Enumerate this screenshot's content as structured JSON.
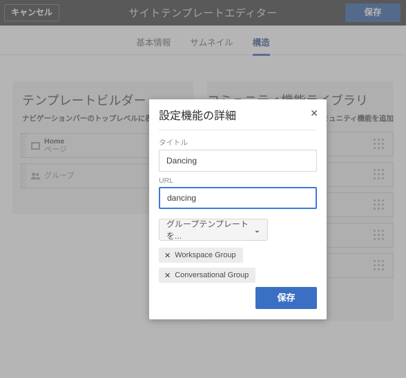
{
  "topbar": {
    "cancel_label": "キャンセル",
    "title": "サイトテンプレートエディター",
    "save_label": "保存"
  },
  "tabs": [
    {
      "label": "基本情報",
      "active": false
    },
    {
      "label": "サムネイル",
      "active": false
    },
    {
      "label": "構造",
      "active": true
    }
  ],
  "left_panel": {
    "title": "テンプレートビルダー",
    "subtitle": "ナビゲーションバーのトップレベルに表示さ",
    "rows": [
      {
        "icon": "page-icon",
        "title": "Home",
        "subtitle": "ページ"
      },
      {
        "icon": "group-icon",
        "title": "",
        "subtitle": "グループ"
      }
    ]
  },
  "right_panel": {
    "title": "コミュニティ機能ライブラリ",
    "subtitle": "コミュニティ機能を追加",
    "rows": [
      {
        "handle": "drag-handle-icon"
      },
      {
        "handle": "drag-handle-icon"
      },
      {
        "handle": "drag-handle-icon"
      },
      {
        "handle": "drag-handle-icon"
      },
      {
        "handle": "drag-handle-icon"
      }
    ]
  },
  "modal": {
    "title": "設定機能の詳細",
    "close_label": "✕",
    "title_field": {
      "label": "タイトル",
      "value": "Dancing",
      "placeholder": "タイトル"
    },
    "url_field": {
      "label": "URL",
      "value": "dancing",
      "placeholder": "URL"
    },
    "select": {
      "value": "グループテンプレートを...",
      "chevron": "⌄"
    },
    "chips": [
      {
        "remove": "✕",
        "label": "Workspace Group"
      },
      {
        "remove": "✕",
        "label": "Conversational Group"
      }
    ],
    "save_label": "保存"
  },
  "colors": {
    "topbar_bg": "#333333",
    "accent_blue": "#3b6fc4",
    "tab_active": "#2a63c4",
    "focus_border": "#3b78d8",
    "card_bg": "#f2f2f2",
    "overlay": "rgba(120,120,120,0.55)"
  }
}
